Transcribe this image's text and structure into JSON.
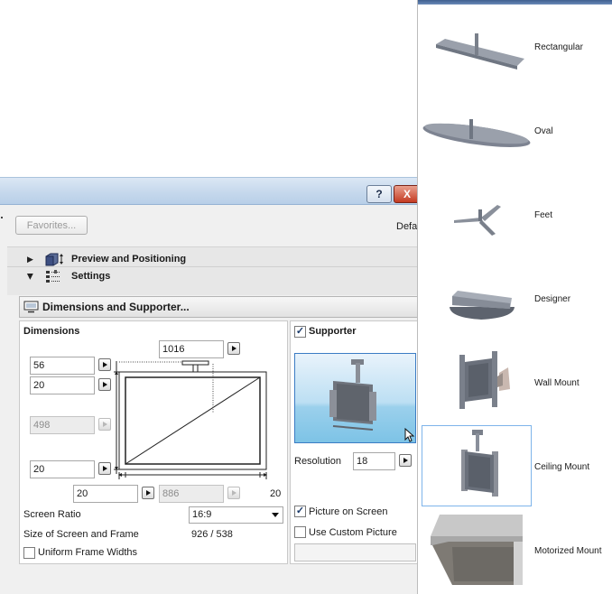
{
  "window": {
    "help_label": "?",
    "close_label": "X"
  },
  "toolbar": {
    "favorites_label": "Favorites...",
    "default_label": "Defa"
  },
  "sections": {
    "preview": "Preview and Positioning",
    "settings": "Settings"
  },
  "dimensions_header": "Dimensions and Supporter...",
  "dimensions": {
    "title": "Dimensions",
    "top_width": "1016",
    "frame_top": "56",
    "gap_top": "20",
    "screen_height": "498",
    "frame_bottom": "20",
    "frame_left": "20",
    "screen_width": "886",
    "frame_right": "20",
    "screen_ratio_label": "Screen Ratio",
    "screen_ratio_value": "16:9",
    "size_label": "Size of Screen and Frame",
    "size_value": "926 /  538",
    "uniform_label": "Uniform Frame Widths",
    "uniform_checked": false
  },
  "supporter": {
    "label": "Supporter",
    "checked": true,
    "resolution_label": "Resolution",
    "resolution_value": "18",
    "picture_on_screen_label": "Picture on Screen",
    "picture_on_screen_checked": true,
    "use_custom_picture_label": "Use Custom Picture",
    "use_custom_picture_checked": false
  },
  "gallery": {
    "items": [
      {
        "label": "Rectangular",
        "icon": "rectangular-mount-icon"
      },
      {
        "label": "Oval",
        "icon": "oval-mount-icon"
      },
      {
        "label": "Feet",
        "icon": "feet-mount-icon"
      },
      {
        "label": "Designer",
        "icon": "designer-mount-icon"
      },
      {
        "label": "Wall Mount",
        "icon": "wall-mount-icon"
      },
      {
        "label": "Ceiling Mount",
        "icon": "ceiling-mount-icon",
        "selected": true
      },
      {
        "label": "Motorized Mount",
        "icon": "motorized-mount-icon"
      }
    ]
  },
  "colors": {
    "title_bar": "#c4d7ec",
    "selection_border": "#7eb4ea",
    "mount_gray": "#7d8391",
    "preview_sky": "#9bd0ec"
  }
}
